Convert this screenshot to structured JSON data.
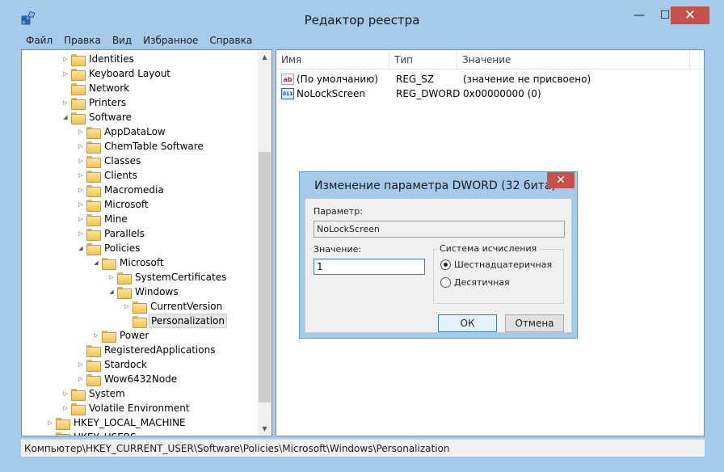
{
  "window": {
    "title": "Редактор реестра",
    "minimize": "—",
    "maximize": "☐",
    "close": "✕"
  },
  "menu": [
    "Файл",
    "Правка",
    "Вид",
    "Избранное",
    "Справка"
  ],
  "tree": [
    {
      "label": "Identities",
      "level": 2,
      "arrow": "collapsed"
    },
    {
      "label": "Keyboard Layout",
      "level": 2,
      "arrow": "collapsed"
    },
    {
      "label": "Network",
      "level": 2,
      "arrow": "none"
    },
    {
      "label": "Printers",
      "level": 2,
      "arrow": "collapsed"
    },
    {
      "label": "Software",
      "level": 2,
      "arrow": "expanded"
    },
    {
      "label": "AppDataLow",
      "level": 3,
      "arrow": "collapsed"
    },
    {
      "label": "ChemTable Software",
      "level": 3,
      "arrow": "collapsed"
    },
    {
      "label": "Classes",
      "level": 3,
      "arrow": "collapsed"
    },
    {
      "label": "Clients",
      "level": 3,
      "arrow": "collapsed"
    },
    {
      "label": "Macromedia",
      "level": 3,
      "arrow": "collapsed"
    },
    {
      "label": "Microsoft",
      "level": 3,
      "arrow": "collapsed"
    },
    {
      "label": "Mine",
      "level": 3,
      "arrow": "collapsed"
    },
    {
      "label": "Parallels",
      "level": 3,
      "arrow": "collapsed"
    },
    {
      "label": "Policies",
      "level": 3,
      "arrow": "expanded"
    },
    {
      "label": "Microsoft",
      "level": 4,
      "arrow": "expanded"
    },
    {
      "label": "SystemCertificates",
      "level": 5,
      "arrow": "collapsed"
    },
    {
      "label": "Windows",
      "level": 5,
      "arrow": "expanded"
    },
    {
      "label": "CurrentVersion",
      "level": 6,
      "arrow": "collapsed"
    },
    {
      "label": "Personalization",
      "level": 6,
      "arrow": "none",
      "selected": true
    },
    {
      "label": "Power",
      "level": 4,
      "arrow": "collapsed"
    },
    {
      "label": "RegisteredApplications",
      "level": 3,
      "arrow": "none"
    },
    {
      "label": "Stardock",
      "level": 3,
      "arrow": "collapsed"
    },
    {
      "label": "Wow6432Node",
      "level": 3,
      "arrow": "collapsed"
    },
    {
      "label": "System",
      "level": 2,
      "arrow": "collapsed"
    },
    {
      "label": "Volatile Environment",
      "level": 2,
      "arrow": "collapsed"
    },
    {
      "label": "HKEY_LOCAL_MACHINE",
      "level": 1,
      "arrow": "collapsed"
    },
    {
      "label": "HKEY_USERS",
      "level": 1,
      "arrow": "collapsed"
    }
  ],
  "list": {
    "headers": {
      "name": "Имя",
      "type": "Тип",
      "value": "Значение"
    },
    "rows": [
      {
        "icon": "ab",
        "icon_kind": "sz",
        "name": "(По умолчанию)",
        "type": "REG_SZ",
        "value": "(значение не присвоено)"
      },
      {
        "icon": "011",
        "icon_kind": "dw",
        "name": "NoLockScreen",
        "type": "REG_DWORD",
        "value": "0x00000000 (0)"
      }
    ]
  },
  "status": "Компьютер\\HKEY_CURRENT_USER\\Software\\Policies\\Microsoft\\Windows\\Personalization",
  "dialog": {
    "title": "Изменение параметра DWORD (32 бита)",
    "close": "✕",
    "param_label": "Параметр:",
    "param_value": "NoLockScreen",
    "value_label": "Значение:",
    "value": "1",
    "base_group": "Система исчисления",
    "hex_label": "Шестнадцатеричная",
    "dec_label": "Десятичная",
    "ok": "ОК",
    "cancel": "Отмена"
  },
  "icons": {
    "scroll_up": "▲",
    "scroll_down": "▼",
    "expanded": "◢",
    "collapsed": "▷"
  }
}
